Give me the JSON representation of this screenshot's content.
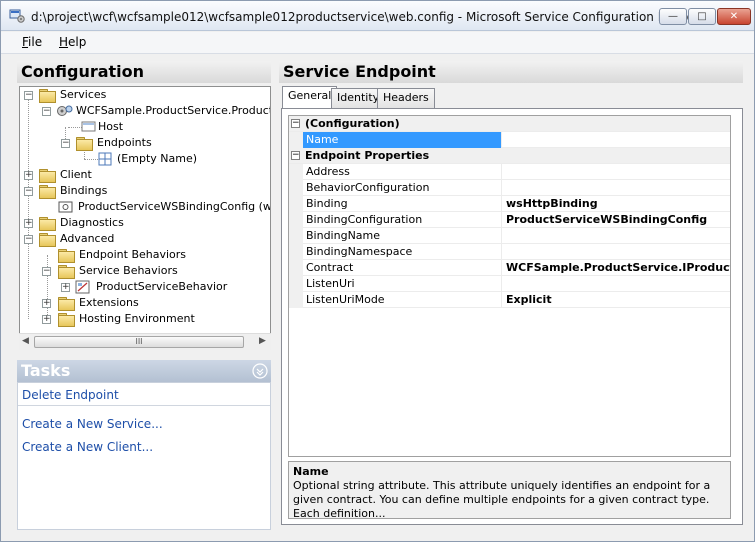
{
  "window": {
    "title": "d:\\project\\wcf\\wcfsample012\\wcfsample012productservice\\web.config - Microsoft Service Configuration Editor",
    "minimize_glyph": "—",
    "maximize_glyph": "□",
    "close_glyph": "✕"
  },
  "menu": {
    "file": {
      "accel": "F",
      "rest": "ile"
    },
    "help": {
      "accel": "H",
      "rest": "elp"
    }
  },
  "configuration": {
    "title": "Configuration",
    "tree": {
      "services": "Services",
      "service_name": "WCFSample.ProductService.ProductSer",
      "host": "Host",
      "endpoints": "Endpoints",
      "empty_name": "(Empty Name)",
      "client": "Client",
      "bindings": "Bindings",
      "binding_item": "ProductServiceWSBindingConfig (wsHttp",
      "diagnostics": "Diagnostics",
      "advanced": "Advanced",
      "endpoint_behaviors": "Endpoint Behaviors",
      "service_behaviors": "Service Behaviors",
      "service_behavior_item": "ProductServiceBehavior",
      "extensions": "Extensions",
      "hosting_environment": "Hosting Environment"
    },
    "scroll_thumb": "III"
  },
  "tasks": {
    "title": "Tasks",
    "delete_endpoint": "Delete Endpoint",
    "create_service": "Create a New Service...",
    "create_client": "Create a New Client..."
  },
  "service_endpoint": {
    "title": "Service Endpoint",
    "tabs": [
      "General",
      "Identity",
      "Headers"
    ],
    "categories": [
      "(Configuration)",
      "Endpoint Properties"
    ],
    "properties": [
      {
        "name": "Name",
        "value": ""
      },
      {
        "name": "Address",
        "value": ""
      },
      {
        "name": "BehaviorConfiguration",
        "value": ""
      },
      {
        "name": "Binding",
        "value": "wsHttpBinding"
      },
      {
        "name": "BindingConfiguration",
        "value": "ProductServiceWSBindingConfig"
      },
      {
        "name": "BindingName",
        "value": ""
      },
      {
        "name": "BindingNamespace",
        "value": ""
      },
      {
        "name": "Contract",
        "value": "WCFSample.ProductService.IProductSer"
      },
      {
        "name": "ListenUri",
        "value": ""
      },
      {
        "name": "ListenUriMode",
        "value": "Explicit"
      }
    ],
    "description": {
      "title": "Name",
      "text": "Optional string attribute. This attribute uniquely identifies an endpoint for a given contract. You can define multiple endpoints for a given contract type. Each definition..."
    }
  },
  "colors": {
    "selection": "#3399ff",
    "link": "#1d4ea8",
    "tasks_header": "#b3c0d2"
  }
}
